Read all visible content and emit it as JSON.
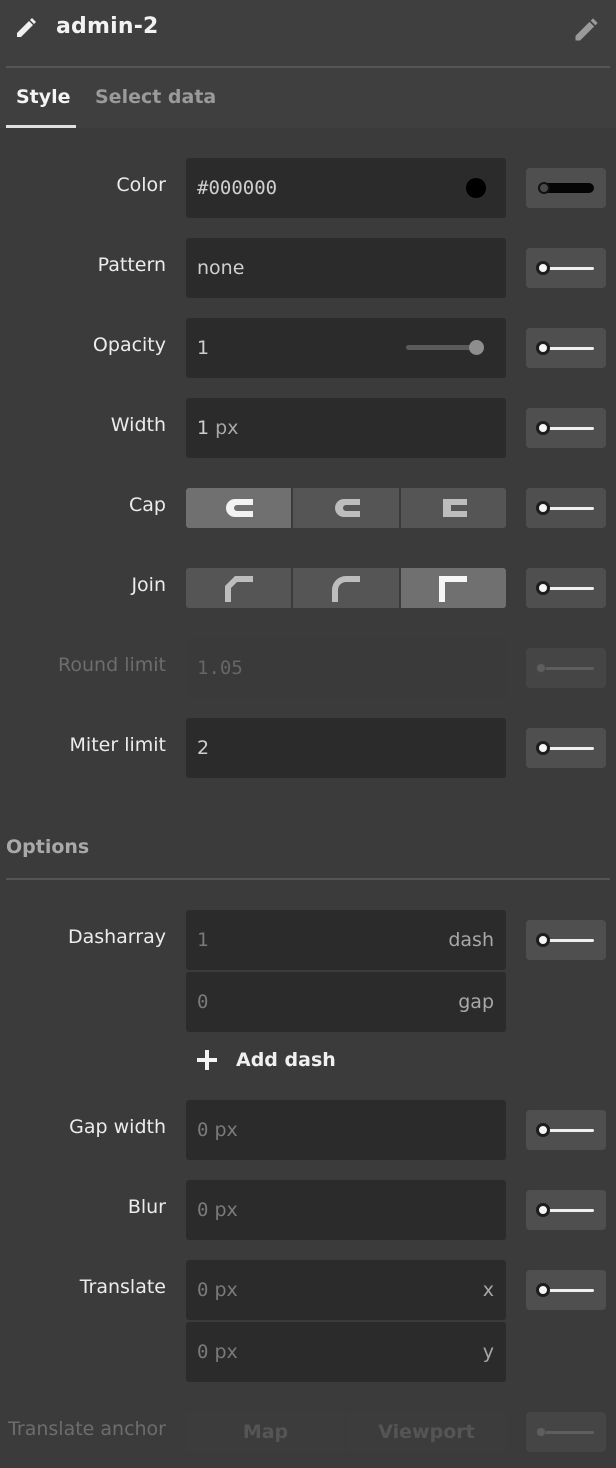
{
  "header": {
    "title": "admin-2"
  },
  "tabs": [
    {
      "label": "Style"
    },
    {
      "label": "Select data"
    }
  ],
  "rows": {
    "color": {
      "label": "Color",
      "value": "#000000",
      "swatch": "#000000"
    },
    "pattern": {
      "label": "Pattern",
      "value": "none"
    },
    "opacity": {
      "label": "Opacity",
      "value": "1",
      "slider_fraction": 1.0
    },
    "width": {
      "label": "Width",
      "value": "1",
      "unit": "px"
    },
    "cap": {
      "label": "Cap",
      "options": [
        "butt-cap",
        "round-cap",
        "square-cap"
      ],
      "selected": "butt-cap"
    },
    "join": {
      "label": "Join",
      "options": [
        "bevel-join",
        "round-join",
        "miter-join"
      ],
      "selected": "miter-join"
    },
    "round_limit": {
      "label": "Round limit",
      "value": "1.05"
    },
    "miter_limit": {
      "label": "Miter limit",
      "value": "2"
    }
  },
  "options_section": {
    "title": "Options",
    "dasharray": {
      "label": "Dasharray",
      "dash_value": "1",
      "dash_suffix": "dash",
      "gap_value": "0",
      "gap_suffix": "gap"
    },
    "add_dash_label": "Add dash",
    "gap_width": {
      "label": "Gap width",
      "value": "0",
      "unit": "px"
    },
    "blur": {
      "label": "Blur",
      "value": "0",
      "unit": "px"
    },
    "translate": {
      "label": "Translate",
      "x_value": "0",
      "y_value": "0",
      "unit": "px",
      "x_suffix": "x",
      "y_suffix": "y"
    },
    "translate_anchor": {
      "label": "Translate anchor",
      "options": [
        "Map",
        "Viewport"
      ]
    }
  },
  "colors": {
    "background": "#3b3b3b",
    "field": "#2b2b2b",
    "accent": "#e0e0e0"
  }
}
